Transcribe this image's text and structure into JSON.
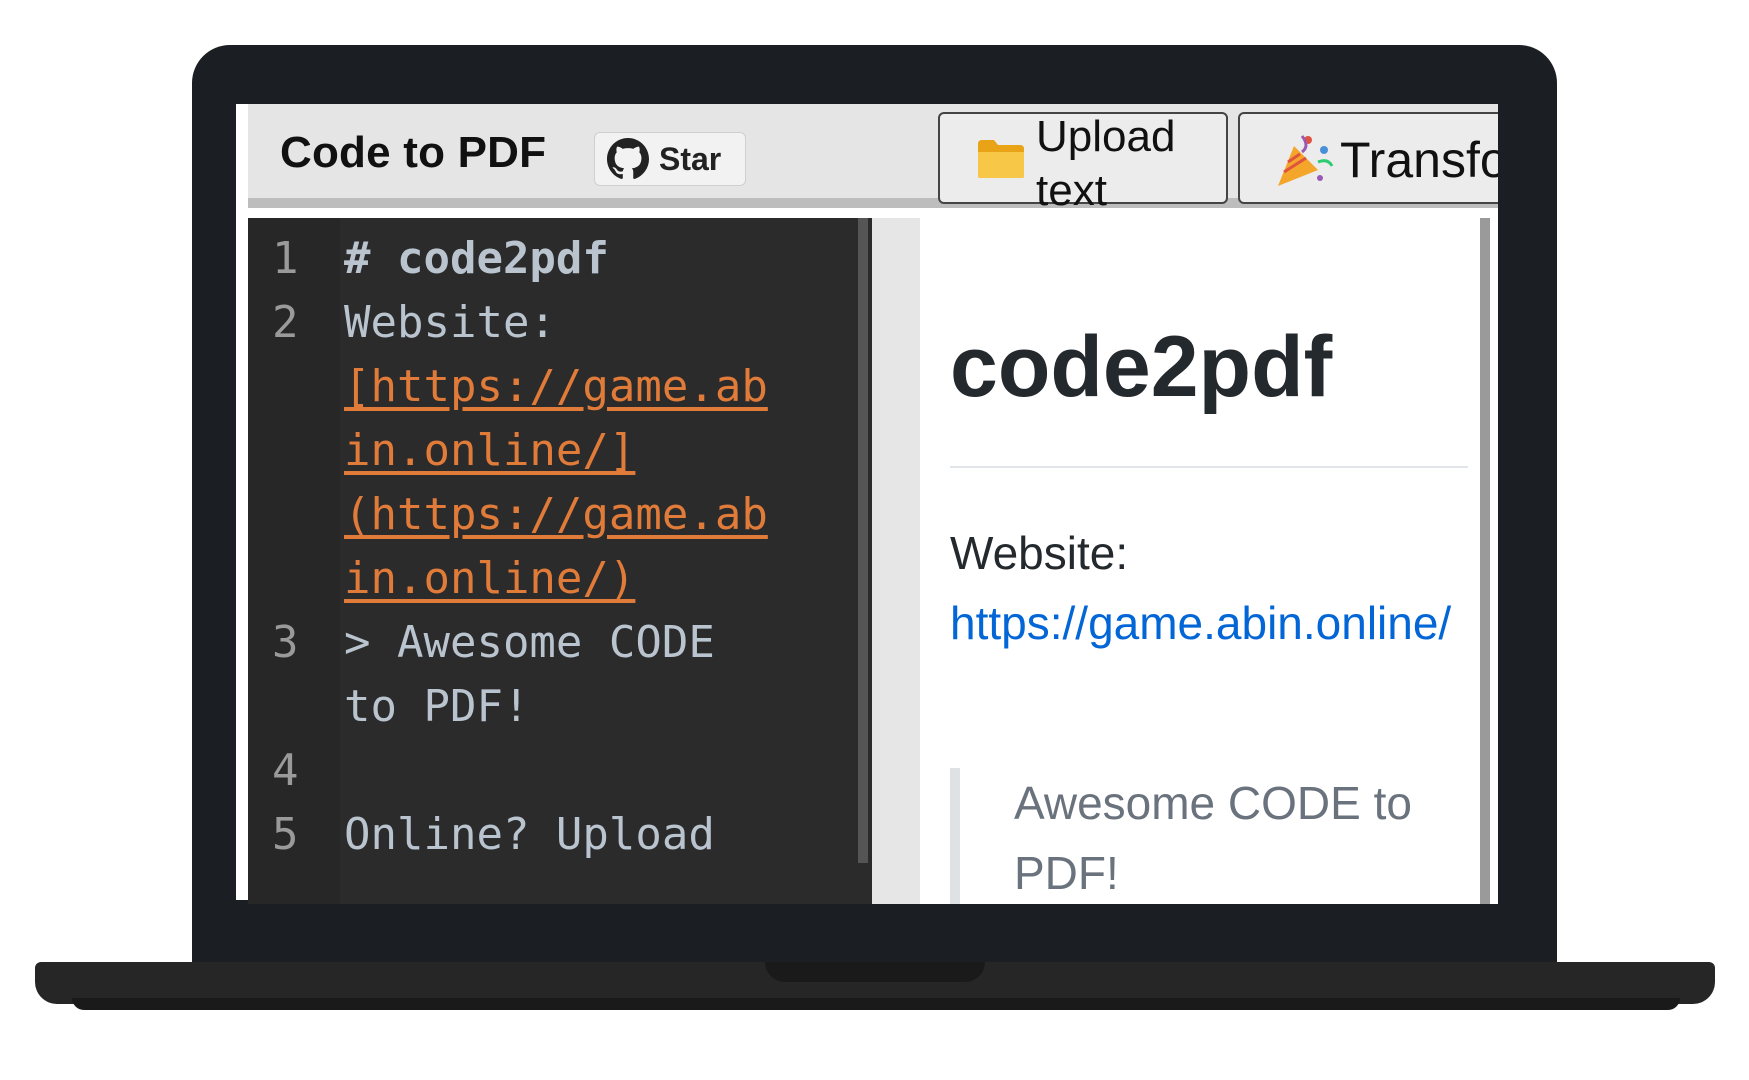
{
  "toolbar": {
    "app_title": "Code to PDF",
    "star_label": "Star",
    "upload_label": "Upload text",
    "transform_label": "Transfo"
  },
  "editor": {
    "lines": [
      {
        "number": "1",
        "parts": [
          {
            "kind": "heading",
            "text": "# code2pdf"
          }
        ]
      },
      {
        "number": "2",
        "parts": [
          {
            "kind": "text",
            "text": "Website:"
          }
        ]
      },
      {
        "number": "",
        "parts": [
          {
            "kind": "link",
            "text": "[https://game.ab"
          }
        ]
      },
      {
        "number": "",
        "parts": [
          {
            "kind": "link",
            "text": "in.online/]"
          }
        ]
      },
      {
        "number": "",
        "parts": [
          {
            "kind": "link",
            "text": "(https://game.ab"
          }
        ]
      },
      {
        "number": "",
        "parts": [
          {
            "kind": "link",
            "text": "in.online/)"
          }
        ]
      },
      {
        "number": "3",
        "parts": [
          {
            "kind": "text",
            "text": "> Awesome CODE"
          }
        ]
      },
      {
        "number": "",
        "parts": [
          {
            "kind": "text",
            "text": "to PDF!"
          }
        ]
      },
      {
        "number": "4",
        "parts": [
          {
            "kind": "text",
            "text": ""
          }
        ]
      },
      {
        "number": "5",
        "parts": [
          {
            "kind": "text",
            "text": "Online? Upload"
          }
        ]
      }
    ]
  },
  "preview": {
    "heading": "code2pdf",
    "website_label": "Website:",
    "website_link": "https://game.abin.online/",
    "quote": "Awesome CODE to PDF!"
  },
  "icons": {
    "github": "github-icon",
    "folder": "folder-icon",
    "party": "party-popper-icon"
  },
  "colors": {
    "editor_bg": "#2b2b2b",
    "code_link": "#e07b39",
    "preview_link": "#0366d6"
  }
}
